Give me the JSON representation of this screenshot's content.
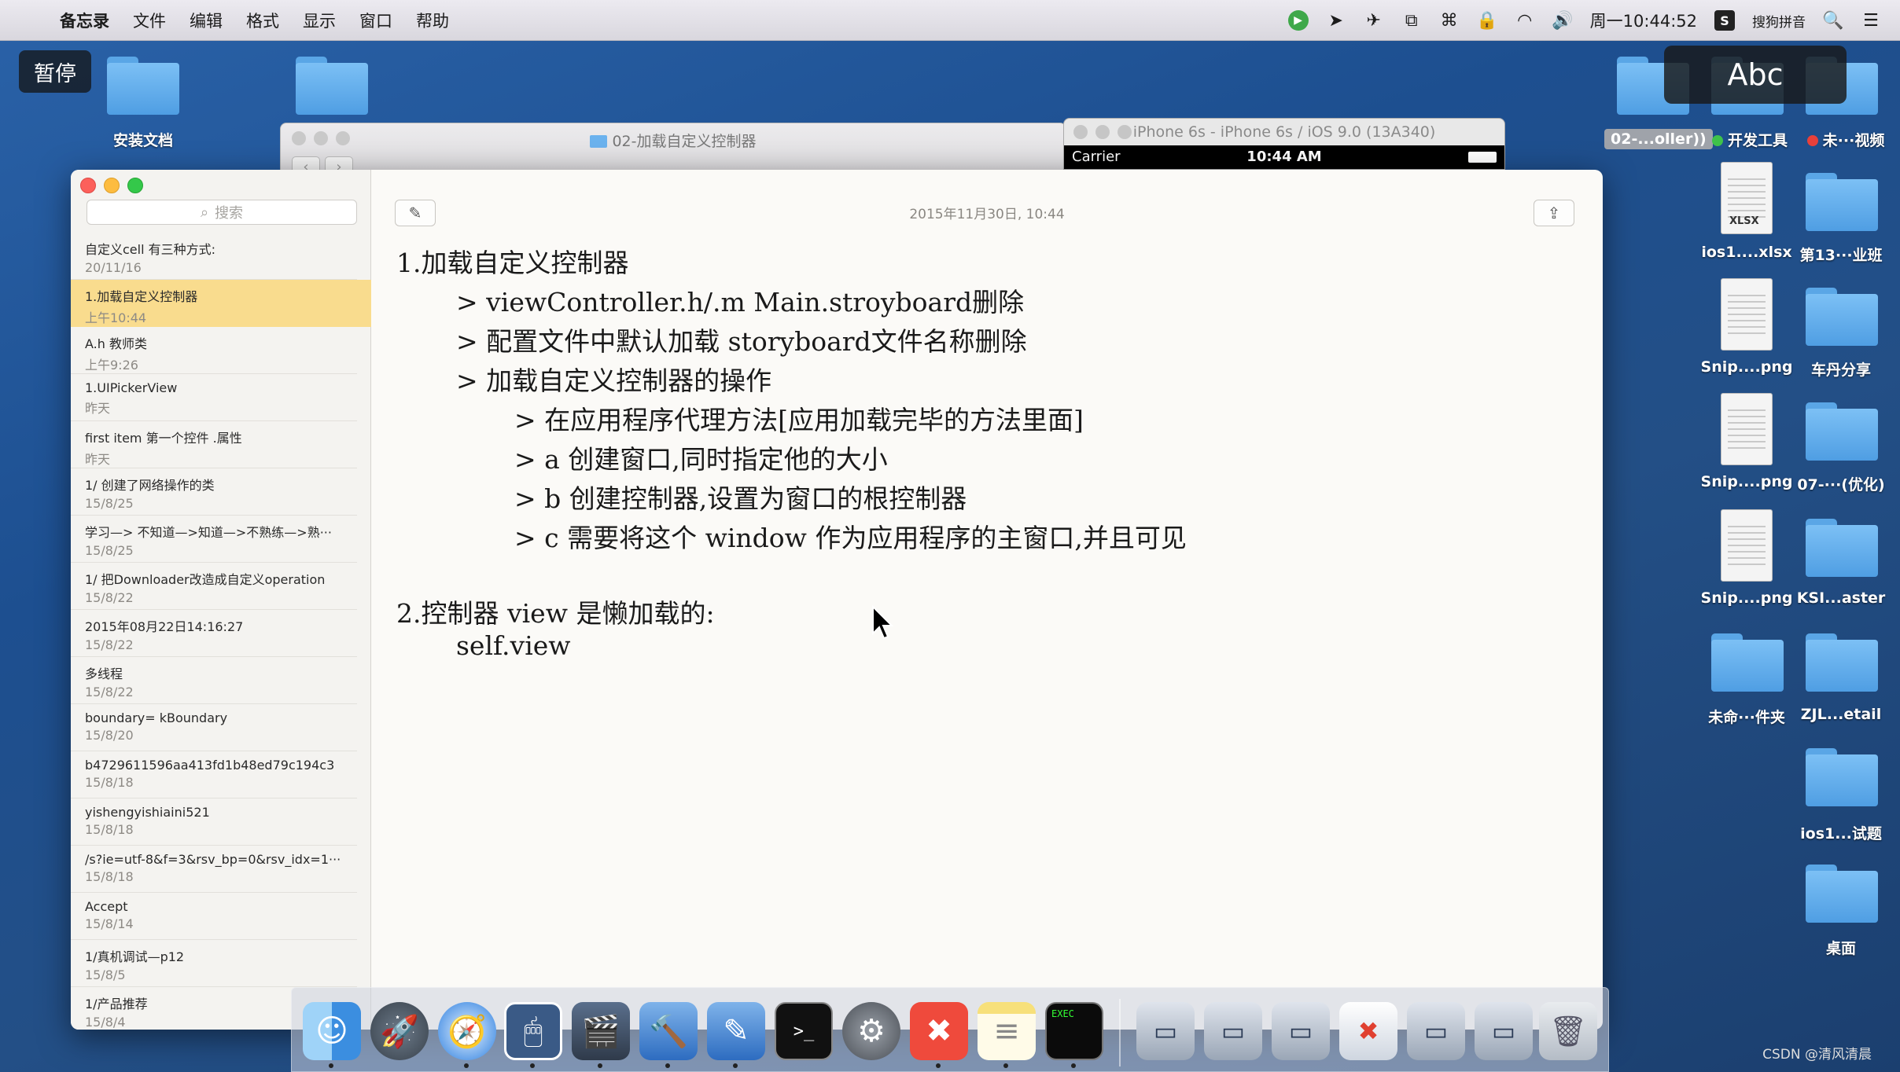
{
  "menubar": {
    "app_name": "备忘录",
    "menus": [
      "文件",
      "编辑",
      "格式",
      "显示",
      "窗口",
      "帮助"
    ],
    "clock": "周一10:44:52",
    "input_method": "搜狗拼音"
  },
  "overlays": {
    "pause": "暂停",
    "input_badge": "Abc"
  },
  "desktop_icons": {
    "left": [
      {
        "label": "安装文档"
      },
      {
        "label": ""
      }
    ],
    "top_right": {
      "selected_label": "02-...oller))",
      "dev_tools_label": "开发工具",
      "video_label": "未···视频"
    },
    "grid": [
      {
        "label": "ios1....xlsx",
        "kind": "xlsx",
        "tag": "XLSX"
      },
      {
        "label": "第13···业班",
        "kind": "folder"
      },
      {
        "label": "Snip....png",
        "kind": "png"
      },
      {
        "label": "车丹分享",
        "kind": "folder"
      },
      {
        "label": "Snip....png",
        "kind": "png"
      },
      {
        "label": "07-···(优化)",
        "kind": "folder"
      },
      {
        "label": "Snip....png",
        "kind": "png"
      },
      {
        "label": "KSI...aster",
        "kind": "folder"
      },
      {
        "label": "未命···件夹",
        "kind": "folder"
      },
      {
        "label": "ZJL...etail",
        "kind": "folder"
      },
      {
        "label": "ios1...试题",
        "kind": "folder"
      },
      {
        "label": "桌面",
        "kind": "folder"
      }
    ]
  },
  "finder": {
    "title": "02-加载自定义控制器"
  },
  "simulator": {
    "title": "iPhone 6s - iPhone 6s / iOS 9.0 (13A340)",
    "carrier": "Carrier",
    "time": "10:44 AM"
  },
  "notes": {
    "search_placeholder": "搜索",
    "list": [
      {
        "title": "自定义cell 有三种方式:",
        "date": "20/11/16"
      },
      {
        "title": "1.加载自定义控制器",
        "date": "上午10:44",
        "active": true
      },
      {
        "title": "A.h  教师类",
        "date": "上午9:26"
      },
      {
        "title": "1.UIPickerView",
        "date": "昨天"
      },
      {
        "title": "first item 第一个控件 .属性",
        "date": "昨天"
      },
      {
        "title": "1/ 创建了网络操作的类",
        "date": "15/8/25"
      },
      {
        "title": "学习—> 不知道—>知道—>不熟练—>熟···",
        "date": "15/8/25"
      },
      {
        "title": "1/ 把Downloader改造成自定义operation",
        "date": "15/8/22"
      },
      {
        "title": "2015年08月22日14:16:27",
        "date": "15/8/22"
      },
      {
        "title": "多线程",
        "date": "15/8/22"
      },
      {
        "title": "boundary= kBoundary",
        "date": "15/8/20"
      },
      {
        "title": "b4729611596aa413fd1b48ed79c194c3",
        "date": "15/8/18"
      },
      {
        "title": "yishengyishiaini521",
        "date": "15/8/18"
      },
      {
        "title": "/s?ie=utf-8&f=3&rsv_bp=0&rsv_idx=1···",
        "date": "15/8/18"
      },
      {
        "title": "Accept",
        "date": "15/8/14"
      },
      {
        "title": "1/真机调试—p12",
        "date": "15/8/5"
      },
      {
        "title": "1/产品推荐",
        "date": "15/8/4"
      }
    ],
    "date_header": "2015年11月30日, 10:44",
    "body_lines": [
      "1.加载自定义控制器",
      ">  viewController.h/.m Main.stroyboard删除",
      ">  配置文件中默认加载 storyboard文件名称删除",
      ">  加载自定义控制器的操作",
      "> 在应用程序代理方法[应用加载完毕的方法里面]",
      "> a 创建窗口,同时指定他的大小",
      "> b 创建控制器,设置为窗口的根控制器",
      "> c 需要将这个 window 作为应用程序的主窗口,并且可见",
      "2.控制器 view 是懒加载的:",
      "self.view"
    ]
  },
  "dock": {
    "apps": [
      "finder-icon",
      "launchpad-icon",
      "safari-icon",
      "mouse-icon",
      "photo-booth-icon",
      "xcode-icon",
      "instruments-icon",
      "terminal-icon",
      "system-preferences-icon",
      "xmind-icon",
      "notes-icon",
      "console-icon",
      "screenshot-icon",
      "screenshot-icon",
      "screenshot-icon",
      "screenshot-icon",
      "screenshot-icon",
      "screenshot-icon",
      "trash-icon"
    ],
    "terminal_text": ">_",
    "console_text": "EXEC"
  },
  "watermark": "CSDN @清风清晨"
}
